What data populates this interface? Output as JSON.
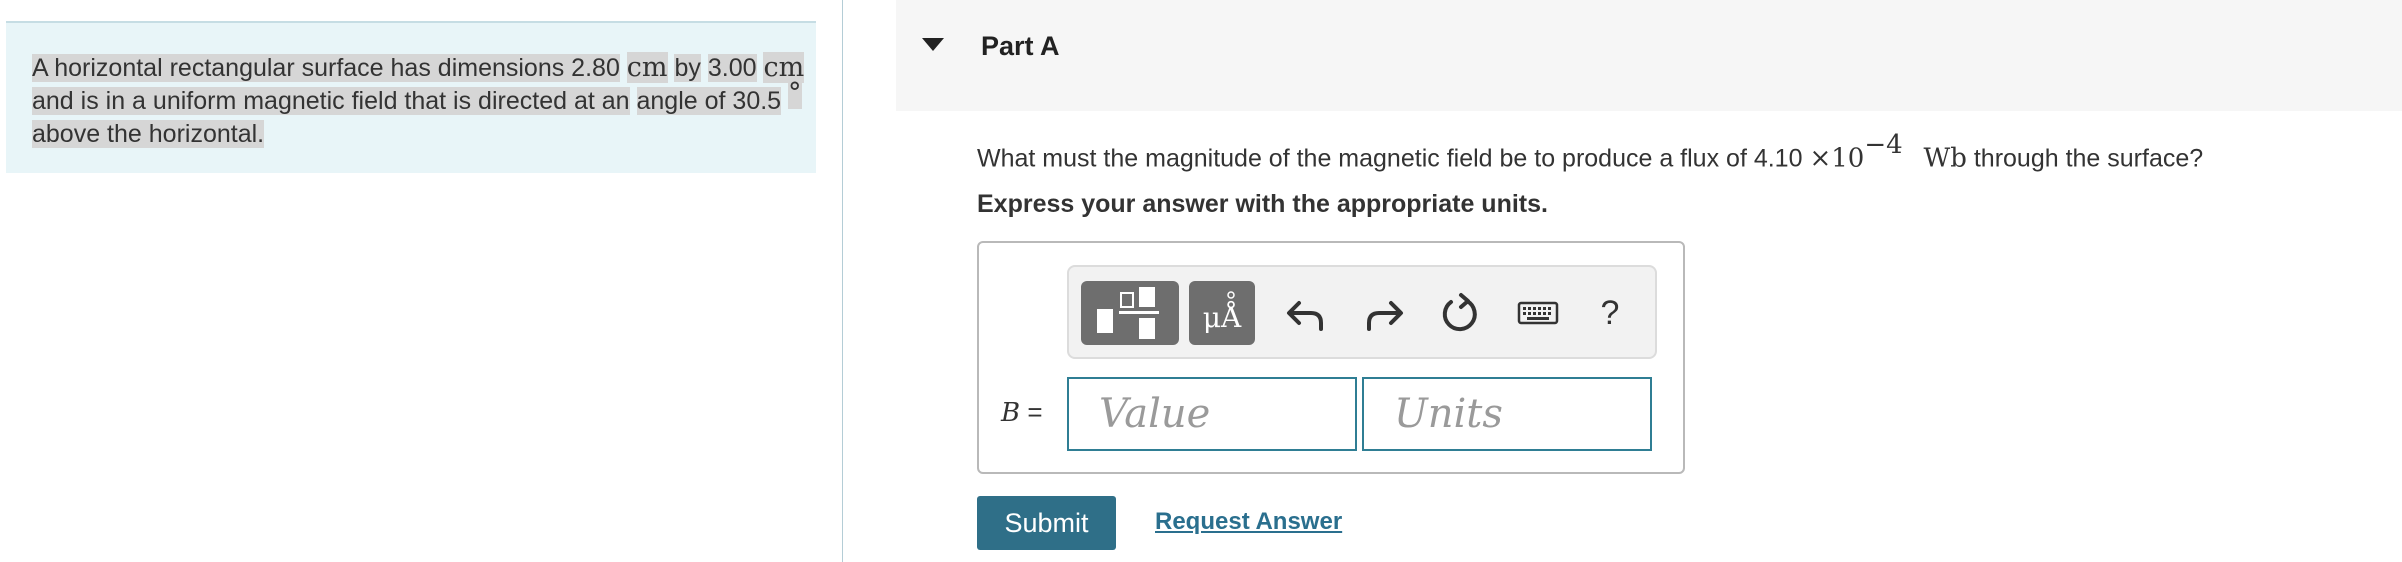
{
  "problem": {
    "t1": "A horizontal rectangular surface has dimensions 2.80",
    "u1": "cm",
    "t2": "by",
    "t3": "3.00",
    "u2": "cm",
    "t4": "and is in a uniform magnetic field that is directed at an",
    "t5": "angle of 30.5",
    "deg": "°",
    "t6": "above the horizontal."
  },
  "part": {
    "title": "Part A"
  },
  "question": {
    "q1": "What must the magnitude of the magnetic field be to produce a flux of 4.10",
    "times": "×",
    "base": "10",
    "exp": "−4",
    "unit": "Wb",
    "q2": "through the surface?"
  },
  "instruction": "Express your answer with the appropriate units.",
  "answer": {
    "label_var": "B",
    "label_eq": " =",
    "value_placeholder": "Value",
    "units_placeholder": "Units"
  },
  "toolbar": {
    "units_symbol": "μÅ",
    "help_symbol": "?"
  },
  "actions": {
    "submit_label": "Submit",
    "request_answer_label": "Request Answer"
  },
  "colors": {
    "left_pane_bg": "#e8f5f8",
    "accent_teal": "#2f7e94",
    "submit_bg": "#2f6f88",
    "toolbar_button_bg": "#6e6e6e"
  }
}
